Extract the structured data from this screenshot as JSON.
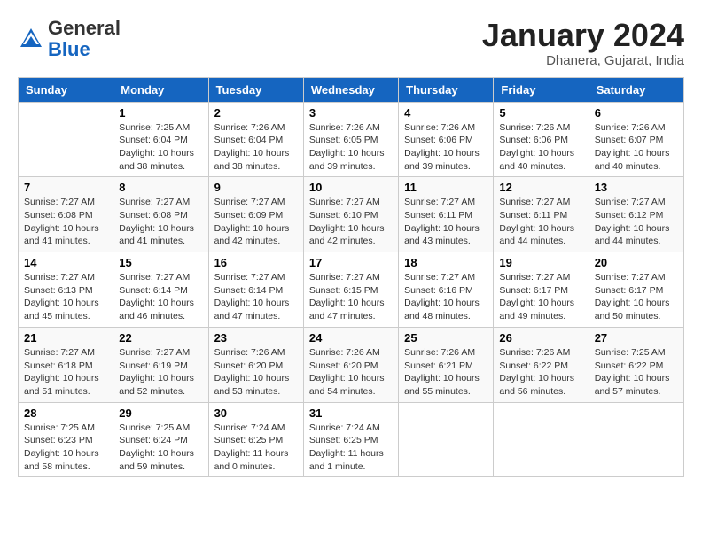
{
  "header": {
    "logo_general": "General",
    "logo_blue": "Blue",
    "month_year": "January 2024",
    "location": "Dhanera, Gujarat, India"
  },
  "days_of_week": [
    "Sunday",
    "Monday",
    "Tuesday",
    "Wednesday",
    "Thursday",
    "Friday",
    "Saturday"
  ],
  "weeks": [
    [
      {
        "num": "",
        "sunrise": "",
        "sunset": "",
        "daylight": ""
      },
      {
        "num": "1",
        "sunrise": "Sunrise: 7:25 AM",
        "sunset": "Sunset: 6:04 PM",
        "daylight": "Daylight: 10 hours and 38 minutes."
      },
      {
        "num": "2",
        "sunrise": "Sunrise: 7:26 AM",
        "sunset": "Sunset: 6:04 PM",
        "daylight": "Daylight: 10 hours and 38 minutes."
      },
      {
        "num": "3",
        "sunrise": "Sunrise: 7:26 AM",
        "sunset": "Sunset: 6:05 PM",
        "daylight": "Daylight: 10 hours and 39 minutes."
      },
      {
        "num": "4",
        "sunrise": "Sunrise: 7:26 AM",
        "sunset": "Sunset: 6:06 PM",
        "daylight": "Daylight: 10 hours and 39 minutes."
      },
      {
        "num": "5",
        "sunrise": "Sunrise: 7:26 AM",
        "sunset": "Sunset: 6:06 PM",
        "daylight": "Daylight: 10 hours and 40 minutes."
      },
      {
        "num": "6",
        "sunrise": "Sunrise: 7:26 AM",
        "sunset": "Sunset: 6:07 PM",
        "daylight": "Daylight: 10 hours and 40 minutes."
      }
    ],
    [
      {
        "num": "7",
        "sunrise": "Sunrise: 7:27 AM",
        "sunset": "Sunset: 6:08 PM",
        "daylight": "Daylight: 10 hours and 41 minutes."
      },
      {
        "num": "8",
        "sunrise": "Sunrise: 7:27 AM",
        "sunset": "Sunset: 6:08 PM",
        "daylight": "Daylight: 10 hours and 41 minutes."
      },
      {
        "num": "9",
        "sunrise": "Sunrise: 7:27 AM",
        "sunset": "Sunset: 6:09 PM",
        "daylight": "Daylight: 10 hours and 42 minutes."
      },
      {
        "num": "10",
        "sunrise": "Sunrise: 7:27 AM",
        "sunset": "Sunset: 6:10 PM",
        "daylight": "Daylight: 10 hours and 42 minutes."
      },
      {
        "num": "11",
        "sunrise": "Sunrise: 7:27 AM",
        "sunset": "Sunset: 6:11 PM",
        "daylight": "Daylight: 10 hours and 43 minutes."
      },
      {
        "num": "12",
        "sunrise": "Sunrise: 7:27 AM",
        "sunset": "Sunset: 6:11 PM",
        "daylight": "Daylight: 10 hours and 44 minutes."
      },
      {
        "num": "13",
        "sunrise": "Sunrise: 7:27 AM",
        "sunset": "Sunset: 6:12 PM",
        "daylight": "Daylight: 10 hours and 44 minutes."
      }
    ],
    [
      {
        "num": "14",
        "sunrise": "Sunrise: 7:27 AM",
        "sunset": "Sunset: 6:13 PM",
        "daylight": "Daylight: 10 hours and 45 minutes."
      },
      {
        "num": "15",
        "sunrise": "Sunrise: 7:27 AM",
        "sunset": "Sunset: 6:14 PM",
        "daylight": "Daylight: 10 hours and 46 minutes."
      },
      {
        "num": "16",
        "sunrise": "Sunrise: 7:27 AM",
        "sunset": "Sunset: 6:14 PM",
        "daylight": "Daylight: 10 hours and 47 minutes."
      },
      {
        "num": "17",
        "sunrise": "Sunrise: 7:27 AM",
        "sunset": "Sunset: 6:15 PM",
        "daylight": "Daylight: 10 hours and 47 minutes."
      },
      {
        "num": "18",
        "sunrise": "Sunrise: 7:27 AM",
        "sunset": "Sunset: 6:16 PM",
        "daylight": "Daylight: 10 hours and 48 minutes."
      },
      {
        "num": "19",
        "sunrise": "Sunrise: 7:27 AM",
        "sunset": "Sunset: 6:17 PM",
        "daylight": "Daylight: 10 hours and 49 minutes."
      },
      {
        "num": "20",
        "sunrise": "Sunrise: 7:27 AM",
        "sunset": "Sunset: 6:17 PM",
        "daylight": "Daylight: 10 hours and 50 minutes."
      }
    ],
    [
      {
        "num": "21",
        "sunrise": "Sunrise: 7:27 AM",
        "sunset": "Sunset: 6:18 PM",
        "daylight": "Daylight: 10 hours and 51 minutes."
      },
      {
        "num": "22",
        "sunrise": "Sunrise: 7:27 AM",
        "sunset": "Sunset: 6:19 PM",
        "daylight": "Daylight: 10 hours and 52 minutes."
      },
      {
        "num": "23",
        "sunrise": "Sunrise: 7:26 AM",
        "sunset": "Sunset: 6:20 PM",
        "daylight": "Daylight: 10 hours and 53 minutes."
      },
      {
        "num": "24",
        "sunrise": "Sunrise: 7:26 AM",
        "sunset": "Sunset: 6:20 PM",
        "daylight": "Daylight: 10 hours and 54 minutes."
      },
      {
        "num": "25",
        "sunrise": "Sunrise: 7:26 AM",
        "sunset": "Sunset: 6:21 PM",
        "daylight": "Daylight: 10 hours and 55 minutes."
      },
      {
        "num": "26",
        "sunrise": "Sunrise: 7:26 AM",
        "sunset": "Sunset: 6:22 PM",
        "daylight": "Daylight: 10 hours and 56 minutes."
      },
      {
        "num": "27",
        "sunrise": "Sunrise: 7:25 AM",
        "sunset": "Sunset: 6:22 PM",
        "daylight": "Daylight: 10 hours and 57 minutes."
      }
    ],
    [
      {
        "num": "28",
        "sunrise": "Sunrise: 7:25 AM",
        "sunset": "Sunset: 6:23 PM",
        "daylight": "Daylight: 10 hours and 58 minutes."
      },
      {
        "num": "29",
        "sunrise": "Sunrise: 7:25 AM",
        "sunset": "Sunset: 6:24 PM",
        "daylight": "Daylight: 10 hours and 59 minutes."
      },
      {
        "num": "30",
        "sunrise": "Sunrise: 7:24 AM",
        "sunset": "Sunset: 6:25 PM",
        "daylight": "Daylight: 11 hours and 0 minutes."
      },
      {
        "num": "31",
        "sunrise": "Sunrise: 7:24 AM",
        "sunset": "Sunset: 6:25 PM",
        "daylight": "Daylight: 11 hours and 1 minute."
      },
      {
        "num": "",
        "sunrise": "",
        "sunset": "",
        "daylight": ""
      },
      {
        "num": "",
        "sunrise": "",
        "sunset": "",
        "daylight": ""
      },
      {
        "num": "",
        "sunrise": "",
        "sunset": "",
        "daylight": ""
      }
    ]
  ]
}
